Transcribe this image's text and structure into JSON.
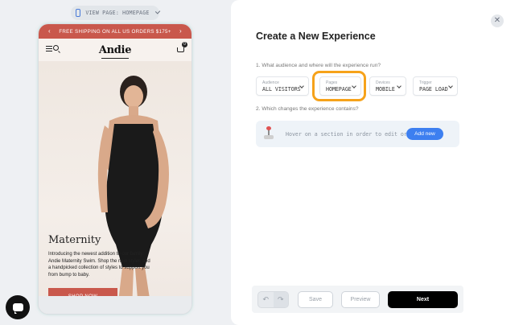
{
  "view_page": {
    "label": "VIEW PAGE: HOMEPAGE"
  },
  "preview": {
    "promo_text": "FREE SHIPPING ON ALL US ORDERS $175+",
    "promo_prev": "‹",
    "promo_next": "›",
    "logo": "Andie",
    "cart_count": "0",
    "hero_title": "Maternity",
    "hero_copy": "Introducing the newest addition to our family: Andie Maternity Swim. Shop the new styles and a handpicked collection of styles to support you from bump to baby.",
    "cta": "SHOP NOW"
  },
  "panel": {
    "close_glyph": "✕",
    "title": "Create a New Experience",
    "question_1": "1. What audience and where will the experience run?",
    "question_2": "2. Which changes the experience contains?",
    "dropdowns": [
      {
        "key": "Audience",
        "value": "ALL VISITORS"
      },
      {
        "key": "Pages",
        "value": "HOMEPAGE"
      },
      {
        "key": "Devices",
        "value": "MOBILE"
      },
      {
        "key": "Trigger",
        "value": "PAGE LOAD"
      }
    ],
    "hover_text": "Hover on a section in order to edit or",
    "add_new": "Add new"
  },
  "footer": {
    "undo": "↶",
    "redo": "↷",
    "save": "Save",
    "preview": "Preview",
    "next": "Next"
  },
  "colors": {
    "brand": "#c9584c",
    "highlight": "#f6a21a",
    "accent": "#3d7ff0"
  }
}
